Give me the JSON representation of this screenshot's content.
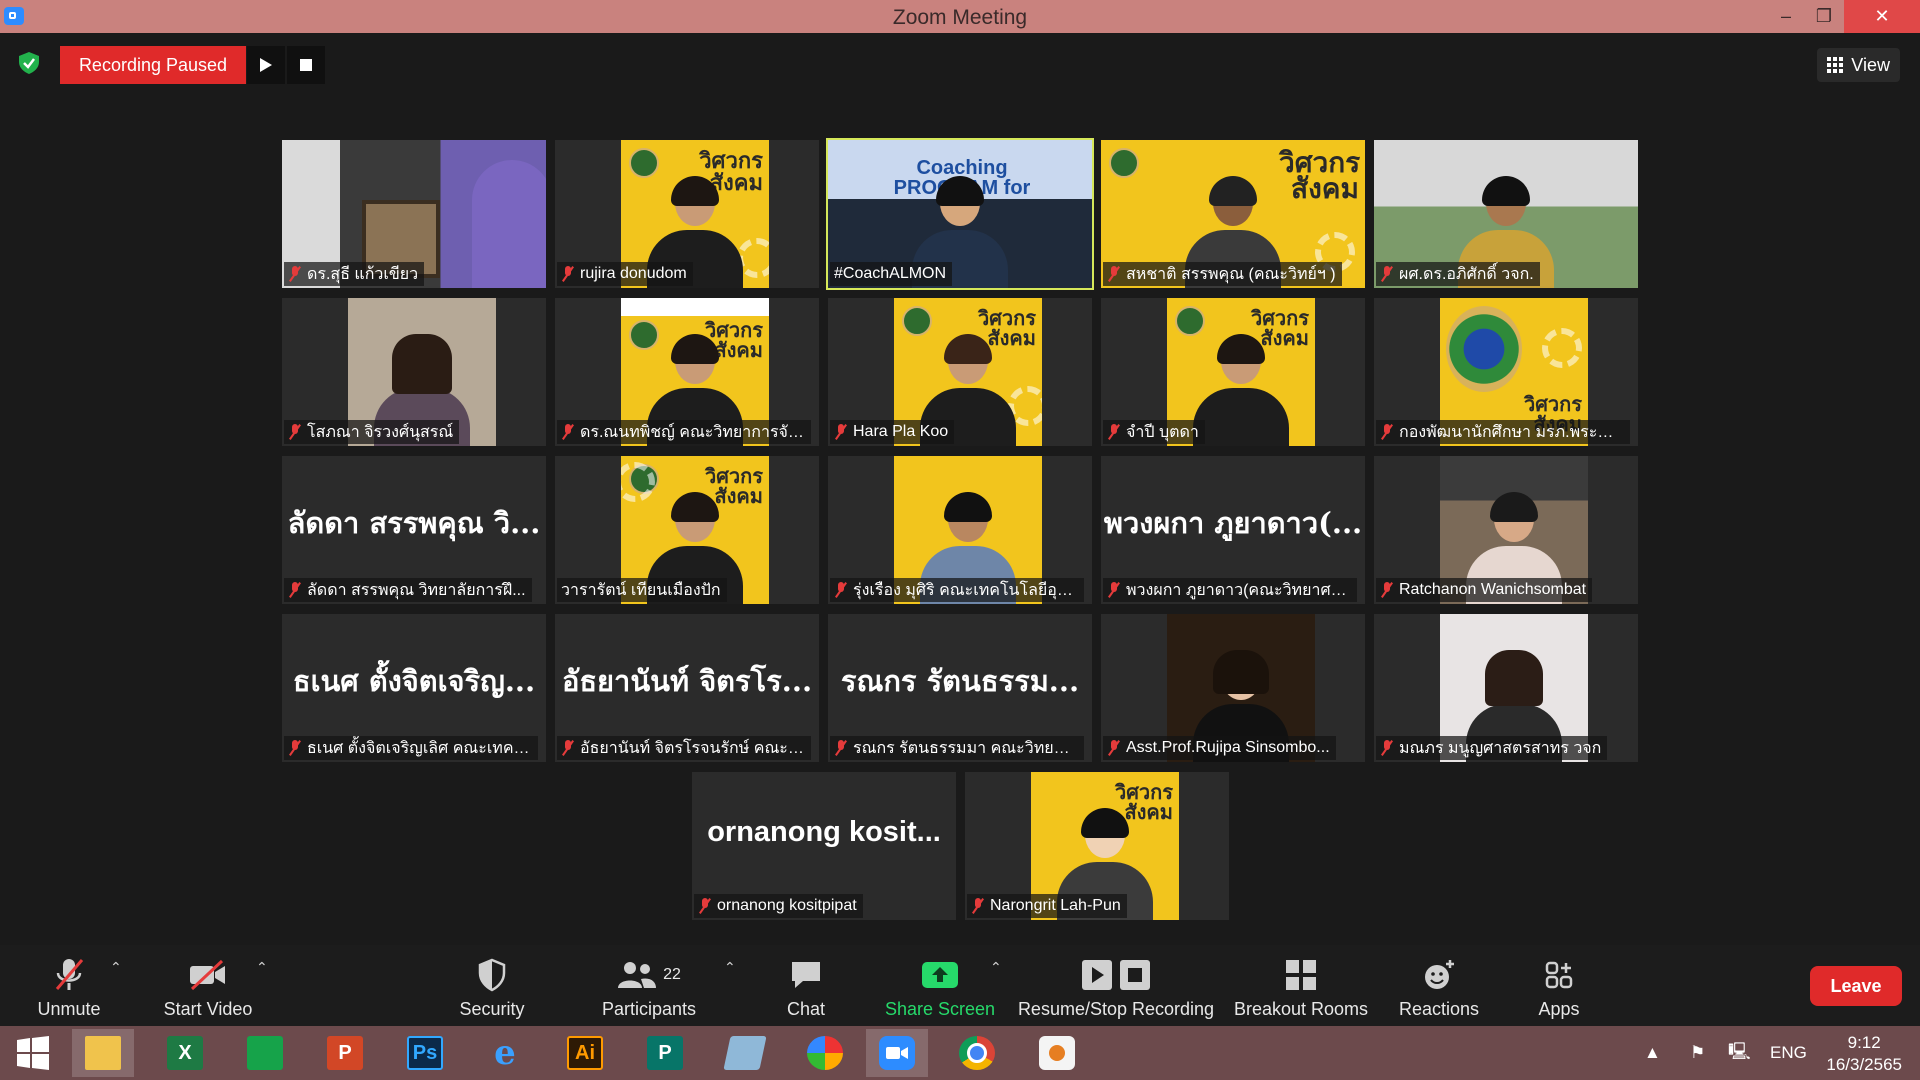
{
  "window": {
    "title": "Zoom Meeting",
    "minimize": "–",
    "maximize": "❐",
    "close": "✕"
  },
  "topbar": {
    "recording_status": "Recording Paused",
    "view_label": "View"
  },
  "participants": [
    {
      "name": "ดร.สุธี แก้วเขียว",
      "tile": "photo"
    },
    {
      "name": "rujira donudom",
      "tile": "poster"
    },
    {
      "name": "#CoachALMON",
      "tile": "photo",
      "speaking": true,
      "banner": "Coaching PROGRAM for Lecturer"
    },
    {
      "name": "สหชาติ สรรพคุณ (คณะวิทย์ฯ )",
      "tile": "poster"
    },
    {
      "name": "ผศ.ดร.อภิศักดิ์ วจก.",
      "tile": "photo"
    },
    {
      "name": "โสภณา จิรวงศ์นุสรณ์",
      "tile": "photo"
    },
    {
      "name": "ดร.ณนทพิชญ์ คณะวิทยาการจัด...",
      "tile": "poster"
    },
    {
      "name": "Hara Pla Koo",
      "tile": "poster"
    },
    {
      "name": "จำปี บุตดา",
      "tile": "poster"
    },
    {
      "name": "กองพัฒนานักศึกษา มรภ.พระนคร",
      "tile": "poster"
    },
    {
      "name": "ลัดดา สรรพคุณ วิทยาลัยการฝึ...",
      "tile": "text",
      "display": "ลัดดา สรรพคุณ วิ..."
    },
    {
      "name": "วารารัตน์ เทียนเมืองปัก",
      "tile": "poster"
    },
    {
      "name": "รุ่งเรือง มุศิริ คณะเทคโนโลยีอุตส...",
      "tile": "poster"
    },
    {
      "name": "พวงผกา ภูยาดาว(คณะวิทยาศา...",
      "tile": "text",
      "display": "พวงผกา ภูยาดาว(..."
    },
    {
      "name": "Ratchanon Wanichsombat",
      "tile": "photo"
    },
    {
      "name": "ธเนศ ตั้งจิตเจริญเลิศ คณะเทคโน...",
      "tile": "text",
      "display": "ธเนศ ตั้งจิตเจริญ..."
    },
    {
      "name": "อัธยานันท์ จิตรโรจนรักษ์ คณะเท...",
      "tile": "text",
      "display": "อัธยานันท์ จิตรโร..."
    },
    {
      "name": "รณกร รัตนธรรมมา คณะวิทยาศ...",
      "tile": "text",
      "display": "รณกร รัตนธรรม..."
    },
    {
      "name": "Asst.Prof.Rujipa Sinsombo...",
      "tile": "photo"
    },
    {
      "name": "มณภร มนูญศาสตรสาทร วจก",
      "tile": "photo"
    },
    {
      "name": "ornanong kositpipat",
      "tile": "text",
      "display": "ornanong kosit..."
    },
    {
      "name": "Narongrit Lah-Pun",
      "tile": "poster"
    }
  ],
  "poster_text": "วิศวกรสังคม",
  "toolbar": {
    "unmute": "Unmute",
    "start_video": "Start Video",
    "security": "Security",
    "participants": "Participants",
    "participants_count": "22",
    "chat": "Chat",
    "share_screen": "Share Screen",
    "recording": "Resume/Stop Recording",
    "breakout_rooms": "Breakout Rooms",
    "reactions": "Reactions",
    "apps": "Apps",
    "leave": "Leave"
  },
  "taskbar": {
    "apps": [
      "start",
      "file-explorer",
      "excel",
      "project",
      "powerpoint",
      "photoshop",
      "internet-explorer",
      "illustrator",
      "publisher",
      "notes",
      "photoscape",
      "zoom",
      "chrome",
      "paint"
    ],
    "ps_label": "Ps",
    "ai_label": "Ai",
    "language": "ENG",
    "time": "9:12",
    "date": "16/3/2565"
  },
  "colors": {
    "accent_red": "#e02a2a",
    "speaking_border": "#d6e85a",
    "share_green": "#26d96a",
    "poster_yellow": "#f2c51d"
  }
}
